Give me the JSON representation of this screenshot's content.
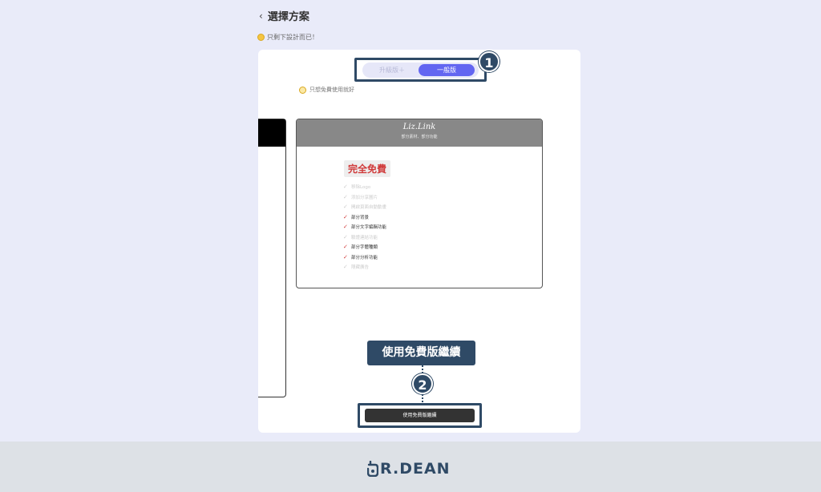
{
  "header": {
    "back_icon": "‹",
    "title": "選擇方案"
  },
  "subtitle": {
    "text": "只剩下設計而已！"
  },
  "toggle": {
    "premium_label": "升級版＋",
    "basic_label": "一般版"
  },
  "badges": {
    "one": "1",
    "two": "2"
  },
  "hint": {
    "text": "只想免費使用就好"
  },
  "plan": {
    "brand": "Liz.Link",
    "description": "部分素材、部分功能",
    "price_label": "完全免費",
    "features": [
      {
        "label": "移除Logo",
        "included": false
      },
      {
        "label": "添加分享圖片",
        "included": false
      },
      {
        "label": "開啟頁面自動動畫",
        "included": false
      },
      {
        "label": "部分背景",
        "included": true
      },
      {
        "label": "部分文字編輯功能",
        "included": true
      },
      {
        "label": "驗證連結功能",
        "included": false
      },
      {
        "label": "部分字體種類",
        "included": true
      },
      {
        "label": "部分分析功能",
        "included": true
      },
      {
        "label": "隱藏廣告",
        "included": false
      }
    ]
  },
  "callout": {
    "text": "使用免費版繼續"
  },
  "cta": {
    "label": "使用免費版繼續"
  },
  "footer": {
    "logo_text": "R.DEAN"
  },
  "colors": {
    "accent": "#6366f1",
    "annotation": "#2f4a66",
    "price": "#d03a3a",
    "page_bg": "#e9ebf9"
  }
}
